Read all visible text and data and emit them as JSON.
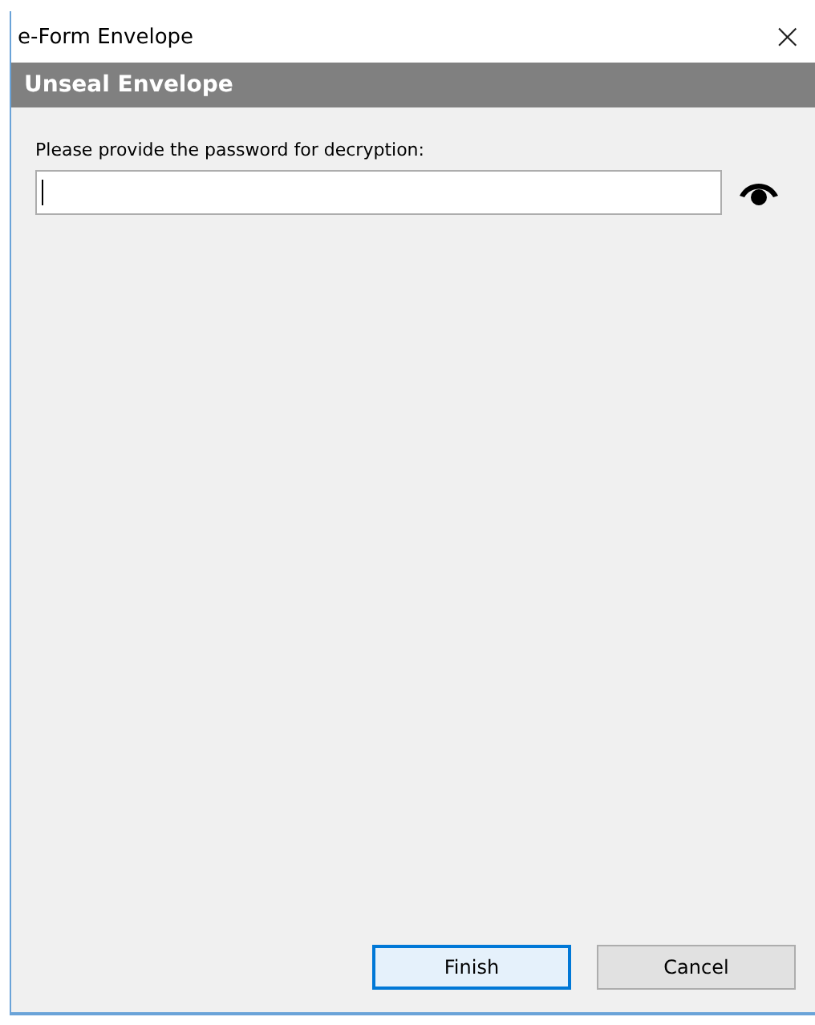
{
  "window": {
    "title": "e-Form Envelope",
    "close": "×"
  },
  "header": {
    "title": "Unseal Envelope"
  },
  "password": {
    "label": "Please provide the password for decryption:",
    "focused": true
  },
  "buttons": [
    {
      "label": "Finish",
      "default": true
    },
    {
      "label": "Cancel",
      "default": false
    }
  ]
}
